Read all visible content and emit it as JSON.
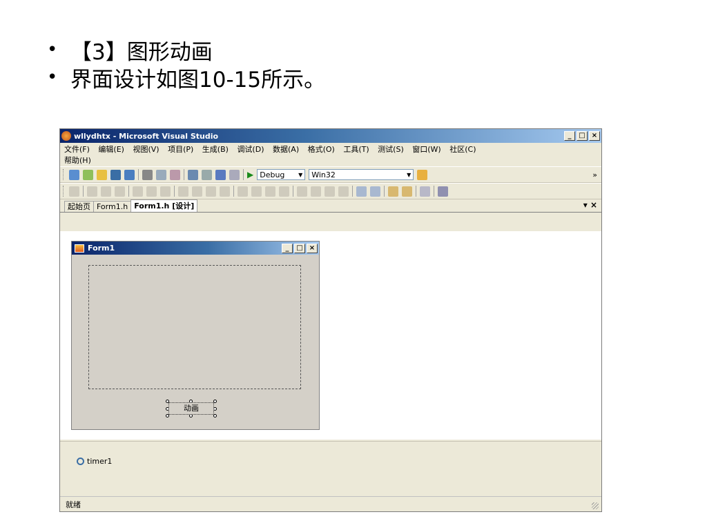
{
  "slide": {
    "bullets": [
      "【3】图形动画",
      "界面设计如图10-15所示。"
    ],
    "bullet_glyph": "•"
  },
  "window": {
    "title": "wllydhtx - Microsoft Visual Studio",
    "caption_buttons": [
      "_",
      "□",
      "×"
    ]
  },
  "menu": [
    "文件(F)",
    "编辑(E)",
    "视图(V)",
    "项目(P)",
    "生成(B)",
    "调试(D)",
    "数据(A)",
    "格式(O)",
    "工具(T)",
    "测试(S)",
    "窗口(W)",
    "社区(C)",
    "帮助(H)"
  ],
  "toolbar": {
    "config": "Debug",
    "platform": "Win32",
    "overflow": "»"
  },
  "tabs": [
    "起始页",
    "Form1.h",
    "Form1.h [设计]"
  ],
  "tab_close": "×",
  "form": {
    "title": "Form1",
    "button_label": "动画"
  },
  "tray": {
    "component": "timer1"
  },
  "status": {
    "text": "就绪"
  },
  "colors": {
    "titlebar": "#0a246a",
    "background": "#ece9d8",
    "form": "#d4d0c8"
  }
}
